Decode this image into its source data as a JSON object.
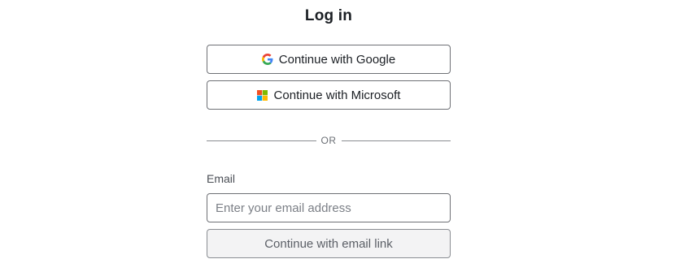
{
  "title": "Log in",
  "sso": {
    "google_label": "Continue with Google",
    "google_icon": "google-icon",
    "microsoft_label": "Continue with Microsoft",
    "microsoft_icon": "microsoft-icon"
  },
  "divider": {
    "label": "OR"
  },
  "email": {
    "label": "Email",
    "placeholder": "Enter your email address",
    "value": "",
    "submit_label": "Continue with email link"
  },
  "colors": {
    "border": "#6e7075",
    "disabled_button_bg": "#f3f3f4",
    "microsoft_red": "#f25022",
    "microsoft_green": "#7fba00",
    "microsoft_blue": "#00a4ef",
    "microsoft_yellow": "#ffb900"
  }
}
